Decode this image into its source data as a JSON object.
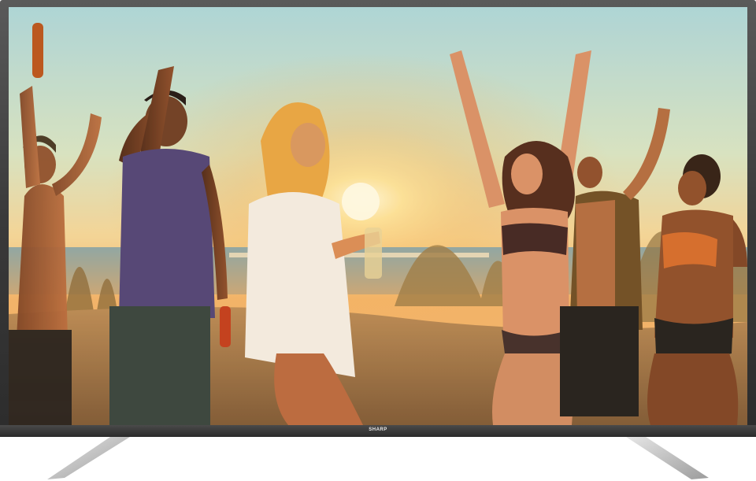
{
  "tv": {
    "brand": "SHARP"
  },
  "scene": {
    "subject": "beach-party-sunset-image"
  },
  "colors": {
    "bezel": "#3a3a3a",
    "stand": "#c8c8c8",
    "sun": "#fff3c0"
  }
}
